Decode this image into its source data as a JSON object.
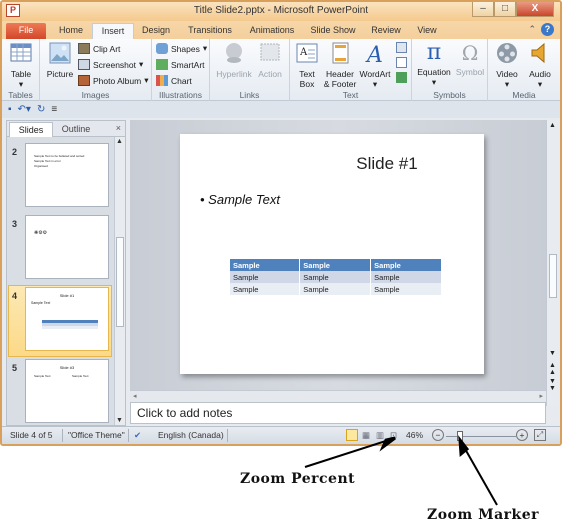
{
  "window": {
    "title": "Title Slide2.pptx - Microsoft PowerPoint",
    "app_icon": "P",
    "minimize": "–",
    "maximize": "□",
    "close": "X"
  },
  "tabs": [
    {
      "label": "File"
    },
    {
      "label": "Home"
    },
    {
      "label": "Insert",
      "active": true
    },
    {
      "label": "Design"
    },
    {
      "label": "Transitions"
    },
    {
      "label": "Animations"
    },
    {
      "label": "Slide Show"
    },
    {
      "label": "Review"
    },
    {
      "label": "View"
    }
  ],
  "ribbon": {
    "groups": [
      {
        "name": "Tables",
        "items": [
          "Table"
        ]
      },
      {
        "name": "Images",
        "items": [
          "Picture",
          "Clip Art",
          "Screenshot",
          "Photo Album"
        ]
      },
      {
        "name": "Illustrations",
        "items": [
          "Shapes",
          "SmartArt",
          "Chart"
        ]
      },
      {
        "name": "Links",
        "items": [
          "Hyperlink",
          "Action"
        ]
      },
      {
        "name": "Text",
        "items": [
          "Text Box",
          "Header & Footer",
          "WordArt"
        ]
      },
      {
        "name": "Symbols",
        "items": [
          "Equation",
          "Symbol"
        ]
      },
      {
        "name": "Media",
        "items": [
          "Video",
          "Audio"
        ]
      }
    ],
    "labels": {
      "table": "Table",
      "picture": "Picture",
      "clipart": "Clip Art",
      "screenshot": "Screenshot",
      "photoalbum": "Photo Album",
      "shapes": "Shapes",
      "smartart": "SmartArt",
      "chart": "Chart",
      "hyperlink": "Hyperlink",
      "action": "Action",
      "textbox1": "Text",
      "textbox2": "Box",
      "header1": "Header",
      "header2": "& Footer",
      "wordart": "WordArt",
      "equation": "Equation",
      "symbol": "Symbol",
      "video": "Video",
      "audio": "Audio"
    }
  },
  "panel": {
    "tabs": [
      "Slides",
      "Outline"
    ],
    "close": "×",
    "thumbnails": [
      {
        "number": "2",
        "lines": [
          "Sample Text to be bulleted and sorted",
          "Sample Text in error",
          "Organised"
        ]
      },
      {
        "number": "3",
        "lines": [
          "❋⚙⚙"
        ]
      },
      {
        "number": "4",
        "title": "Slide #1",
        "bullet": "Sample Text",
        "selected": true
      },
      {
        "number": "5",
        "title": "Slide #3",
        "bullets": [
          "Sample Text",
          "Sample Text"
        ]
      }
    ]
  },
  "slide": {
    "title": "Slide #1",
    "bullet": "Sample Text",
    "table": {
      "header": [
        "Sample",
        "Sample",
        "Sample"
      ],
      "rows": [
        [
          "Sample",
          "Sample",
          "Sample"
        ],
        [
          "Sample",
          "Sample",
          "Sample"
        ]
      ]
    }
  },
  "notes": {
    "placeholder": "Click to add notes"
  },
  "status": {
    "slide_info": "Slide 4 of 5",
    "theme": "\"Office Theme\"",
    "language": "English (Canada)",
    "zoom_percent": "46%",
    "zoom_level": 46,
    "zoom_minus": "−",
    "zoom_plus": "+"
  },
  "annotations": {
    "zoom_percent": "Zoom Percent",
    "zoom_marker": "Zoom Marker"
  }
}
